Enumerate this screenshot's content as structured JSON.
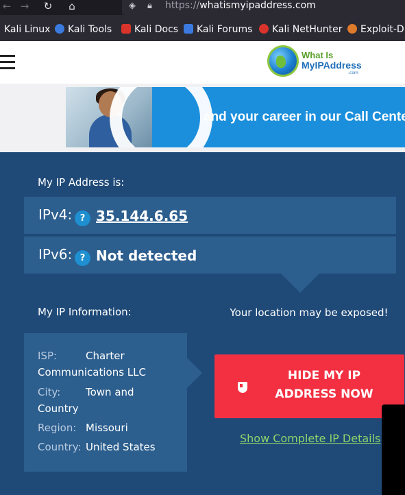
{
  "browser": {
    "url_prefix": "https://",
    "url_host": "whatismyipaddress.com",
    "nav_icons": [
      "back-arrow-icon",
      "forward-arrow-icon",
      "reload-icon",
      "home-icon"
    ],
    "bookmarks": [
      {
        "label": "Kali Linux",
        "icon": "kali-icon"
      },
      {
        "label": "Kali Tools",
        "icon": "kali-tools-icon",
        "color": "#3b7be0"
      },
      {
        "label": "Kali Docs",
        "icon": "kali-docs-icon",
        "color": "#d9342b"
      },
      {
        "label": "Kali Forums",
        "icon": "kali-forums-icon",
        "color": "#3b7be0"
      },
      {
        "label": "Kali NetHunter",
        "icon": "kali-nethunter-icon",
        "color": "#d9342b"
      },
      {
        "label": "Exploit-DB",
        "icon": "exploit-db-icon",
        "color": "#e07a2b"
      }
    ]
  },
  "header": {
    "logo_line1": "What Is",
    "logo_line2": "MyIPAddress",
    "logo_suffix": ".com"
  },
  "ad": {
    "text": "and your career in our Call Center"
  },
  "ip": {
    "heading": "My IP Address is:",
    "ipv4_label": "IPv4:",
    "ipv4_value": "35.144.6.65",
    "ipv6_label": "IPv6:",
    "ipv6_value": "Not detected",
    "help_glyph": "?"
  },
  "info": {
    "heading": "My IP Information:",
    "isp_label": "ISP:",
    "isp_value_1": "Charter",
    "isp_value_2": "Communications LLC",
    "city_label": "City:",
    "city_value_1": "Town and",
    "city_value_2": "Country",
    "region_label": "Region:",
    "region_value": "Missouri",
    "country_label": "Country:",
    "country_value": "United States"
  },
  "cta": {
    "location_note": "Your location may be exposed!",
    "hide_line1": "HIDE MY IP",
    "hide_line2": "ADDRESS NOW",
    "details_link": "Show Complete IP Details"
  },
  "colors": {
    "panel_bg": "#1f4a78",
    "row_bg": "#2c5e8e",
    "cta_red": "#f23041",
    "link_green": "#8cd56a"
  }
}
